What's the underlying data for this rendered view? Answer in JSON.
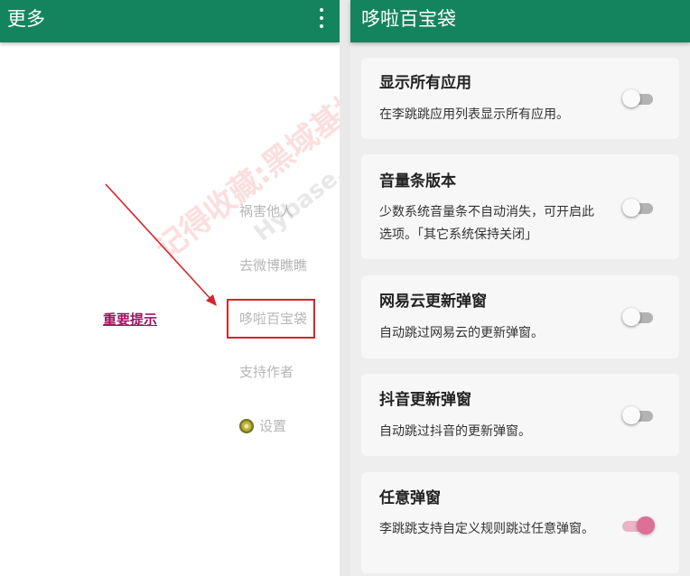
{
  "left_panel": {
    "title": "更多",
    "menu_items": [
      {
        "label": "祸害他人"
      },
      {
        "label": "去微博瞧瞧"
      },
      {
        "label": "哆啦百宝袋"
      },
      {
        "label": "支持作者"
      },
      {
        "label": "设置"
      }
    ],
    "important_link": "重要提示",
    "icons": [
      "more-vert-icon",
      "kiwi-icon"
    ]
  },
  "watermark": {
    "text": "记得收藏:黑域基地",
    "text2": "Hybase.com"
  },
  "right_panel": {
    "title": "哆啦百宝袋",
    "settings": [
      {
        "title": "显示所有应用",
        "desc": "在李跳跳应用列表显示所有应用。",
        "enabled": false
      },
      {
        "title": "音量条版本",
        "desc": "少数系统音量条不自动消失，可开启此选项。「其它系统保持关闭」",
        "enabled": false
      },
      {
        "title": "网易云更新弹窗",
        "desc": "自动跳过网易云的更新弹窗。",
        "enabled": false
      },
      {
        "title": "抖音更新弹窗",
        "desc": "自动跳过抖音的更新弹窗。",
        "enabled": false
      },
      {
        "title": "任意弹窗",
        "desc": "李跳跳支持自定义规则跳过任意弹窗。",
        "enabled": true
      }
    ]
  },
  "colors": {
    "appbar": "#14845e",
    "highlight": "#d7242d",
    "link": "#a2125e",
    "switch_on": "#de6f97",
    "switch_off": "#b3b3b3"
  }
}
